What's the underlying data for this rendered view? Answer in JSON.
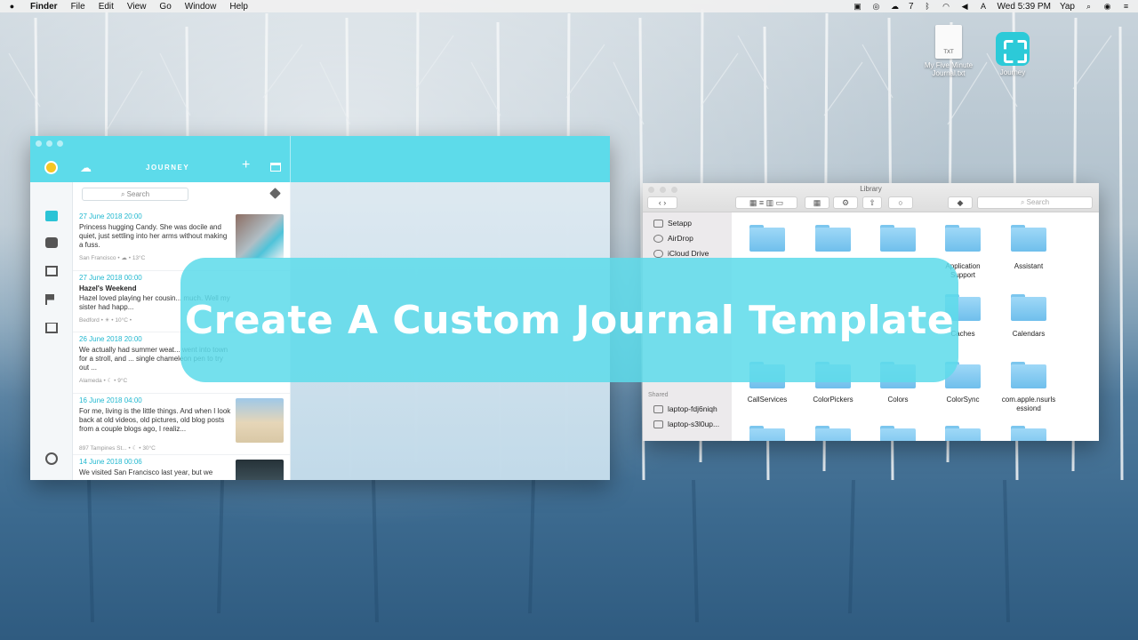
{
  "menubar": {
    "apple": "",
    "app_name": "Finder",
    "menus": [
      "File",
      "Edit",
      "View",
      "Go",
      "Window",
      "Help"
    ],
    "status_icons": [
      "screen-record-icon",
      "circle-icon",
      "cloud-icon",
      "a-icon"
    ],
    "notification_count": "7",
    "clock": "Wed 5:39 PM",
    "user": "Yap"
  },
  "desktop": {
    "icons": [
      {
        "label": "My Five Minute Journal.txt",
        "badge": "TXT"
      },
      {
        "label": "Journey"
      }
    ]
  },
  "journey": {
    "title": "JOURNEY",
    "search_placeholder": "Search",
    "entries": [
      {
        "date": "27 June 2018 20:00",
        "title": "",
        "text": "Princess hugging Candy. She was docile and quiet, just settling into her arms without making a fuss.",
        "meta": "San Francisco • ☁ • 13°C"
      },
      {
        "date": "27 June 2018 00:00",
        "title": "Hazel's Weekend",
        "text": "Hazel loved playing her cousin... much. Well my sister had happ...",
        "meta": "Bedford • ☀ • 10°C •"
      },
      {
        "date": "26 June 2018 20:00",
        "title": "",
        "text": "We actually had summer weat... went into town for a stroll, and ... single chameleon pen to try out ...",
        "meta": "Alameda • ☾ • 9°C"
      },
      {
        "date": "16 June 2018 04:00",
        "title": "",
        "text": "For me, living is the little things. And when I look back at old videos, old pictures, old blog posts from a couple blogs ago, I realiz...",
        "meta": "897 Tampines St... • ☾ • 30°C"
      },
      {
        "date": "14 June 2018 00:06",
        "title": "",
        "text": "We visited San Francisco last year, but we",
        "meta": ""
      }
    ]
  },
  "finder": {
    "title": "Library",
    "search_placeholder": "Search",
    "sidebar": {
      "favorites": [
        "Setapp",
        "AirDrop",
        "iCloud Drive"
      ],
      "shared_header": "Shared",
      "shared": [
        "laptop-fdj6niq​h",
        "laptop-s3l0up..."
      ]
    },
    "row1": [
      "",
      "",
      "",
      "Application\nSupport",
      "Assistant"
    ],
    "row2": [
      "",
      "",
      "",
      "Caches",
      "Calendars"
    ],
    "row3": [
      "CallServices",
      "ColorPickers",
      "Colors",
      "ColorSync",
      "com.apple.nsurls\nessiond"
    ]
  },
  "banner": {
    "text": "Create A Custom Journal Template"
  },
  "colors": {
    "journey_accent": "#5ddbea",
    "folder_blue": "#7cc6ee",
    "date_blue": "#22b8d0"
  }
}
